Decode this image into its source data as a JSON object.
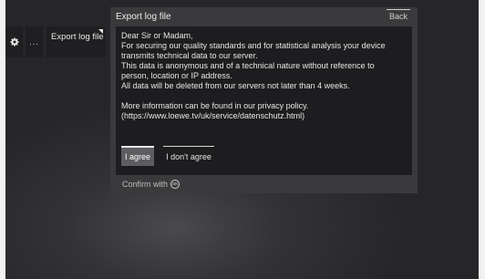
{
  "menu": {
    "more_label": "...",
    "export_label": "Export log file"
  },
  "dialog": {
    "title": "Export log file",
    "back_label": "Back",
    "message": "Dear Sir or Madam,\nFor securing our quality standards and for statistical analysis your device\ntransmits technical data to our server.\nThis data is anonymous and of a technical nature without reference to\nperson, location or IP address.\nAll data will be deleted from our servers not later than 4 weeks.\n\nMore information can be found in our privacy policy.\n(https://www.loewe.tv/uk/service/datenschutz.html)",
    "agree_label": "I agree",
    "disagree_label": "I don't agree",
    "confirm_label": "Confirm with",
    "confirm_icon_text": "OK"
  }
}
